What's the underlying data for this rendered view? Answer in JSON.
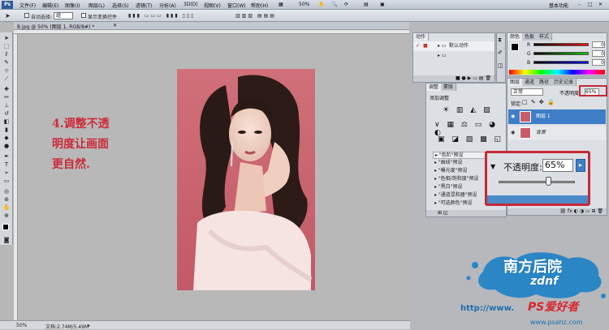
{
  "menubar": {
    "app_icon": "Ps",
    "items": [
      "文件(F)",
      "编辑(E)",
      "图像(I)",
      "图层(L)",
      "选择(S)",
      "滤镜(T)",
      "分析(A)",
      "3D(D)",
      "视图(V)",
      "窗口(W)",
      "帮助(H)"
    ],
    "zoom": "50%",
    "workspace": "基本功能"
  },
  "options": {
    "auto_select_label": "自动选择:",
    "auto_select_value": "组",
    "show_transform_label": "显示变换控件"
  },
  "document": {
    "tab_title": "B.jpg @ 50% (图层 1, RGB/8#) *",
    "caption_lines": [
      "4.调整不透",
      "明度让画面",
      "更自然."
    ],
    "status_zoom": "50%",
    "status_doc": "文档:2.74M/5.49M"
  },
  "actions_panel": {
    "tabs": [
      "动作"
    ],
    "rows": [
      "默认动作",
      ""
    ]
  },
  "color_panel": {
    "tabs": [
      "颜色",
      "色板",
      "样式"
    ],
    "channels": [
      "R",
      "G",
      "B"
    ],
    "values": [
      "0",
      "0",
      "0"
    ]
  },
  "adjust_panel": {
    "tabs": [
      "调整",
      "蒙版"
    ],
    "header": "添加调整",
    "presets": [
      "\"色阶\"预设",
      "\"曲线\"预设",
      "\"曝光度\"预设",
      "\"色相/饱和度\"预设",
      "\"黑白\"预设",
      "\"通道混和器\"预设",
      "\"可选颜色\"预设"
    ]
  },
  "layers_panel": {
    "tabs": [
      "图层",
      "通道",
      "路径",
      "历史记录"
    ],
    "blend_mode": "正常",
    "opacity_label": "不透明度:",
    "opacity_value": "65%",
    "lock_label": "锁定:",
    "fill_label": "填充:",
    "fill_value": "100%",
    "layers": [
      {
        "name": "图层 1",
        "selected": true
      },
      {
        "name": "背景",
        "selected": false
      }
    ]
  },
  "callout": {
    "opacity_label": "不透明度:",
    "opacity_value": "65%",
    "opacity_level": 0.65
  },
  "watermark": {
    "brand": "南方后院",
    "brand_sub": "zdnf",
    "url": "http://www.",
    "ps": "PS爱好者",
    "site": "www.psahz.com"
  },
  "colors": {
    "accent": "#c62838",
    "selection": "#3d7ec7",
    "caption": "#cc2a3a"
  }
}
